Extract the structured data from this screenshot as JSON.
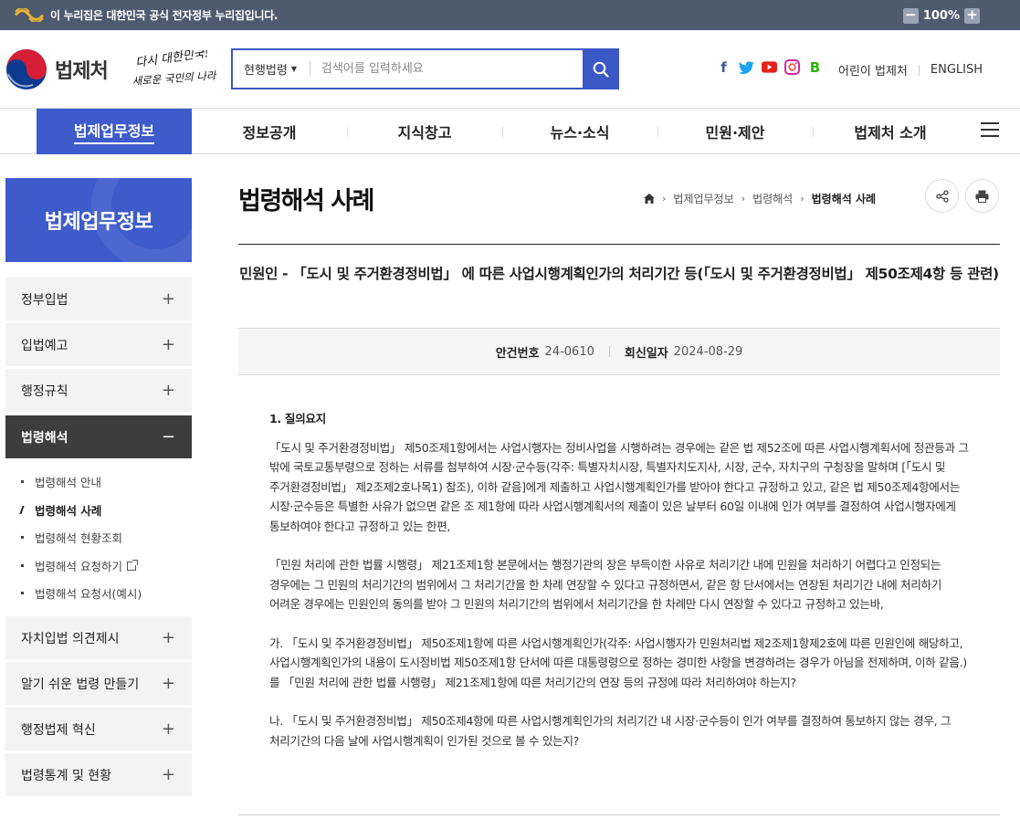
{
  "govbar": {
    "text": "이 누리집은 대한민국 공식 전자정부 누리집입니다.",
    "zoom_minus": "−",
    "zoom_value": "100%",
    "zoom_plus": "+"
  },
  "header": {
    "logo_text": "법제처",
    "slogan_line1": "다시 대한민국!",
    "slogan_line2": "새로운 국민의 나라",
    "search_select": "현행법령",
    "search_placeholder": "검색어를 입력하세요",
    "social": [
      "f",
      "t",
      "▶",
      "◎",
      "B"
    ],
    "util": [
      "어린이 법제처",
      "ENGLISH"
    ]
  },
  "gnb": {
    "items": [
      "법제업무정보",
      "정보공개",
      "지식창고",
      "뉴스·소식",
      "민원·제안",
      "법제처 소개"
    ]
  },
  "sidebar": {
    "title": "법제업무정보",
    "items_top": [
      "정부입법",
      "입법예고",
      "행정규칙"
    ],
    "open_item": "법령해석",
    "sub_items": [
      "법령해석 안내",
      "법령해석 사례",
      "법령해석 현황조회",
      "법령해석 요청하기",
      "법령해석 요청서(예시)"
    ],
    "items_bottom": [
      "자치입법 의견제시",
      "알기 쉬운 법령 만들기",
      "행정법제 혁신",
      "법령통계 및 현황"
    ],
    "plus": "+",
    "minus": "−"
  },
  "content": {
    "page_title": "법령해석 사례",
    "breadcrumb": [
      "법제업무정보",
      "법령해석",
      "법령해석 사례"
    ],
    "doc_title": "민원인 - 「도시 및 주거환경정비법」 에 따른 사업시행계획인가의 처리기간 등(「도시 및 주거환경정비법」 제50조제4항 등 관련)",
    "meta": {
      "case_label": "안건번호",
      "case_value": "24-0610",
      "date_label": "회신일자",
      "date_value": "2024-08-29"
    },
    "section_heading": "1. 질의요지",
    "paragraphs": [
      "「도시 및 주거환경정비법」 제50조제1항에서는 사업시행자는 정비사업을 시행하려는 경우에는 같은 법 제52조에 따른 사업시행계획서에 정관등과 그 밖에 국토교통부령으로 정하는 서류를 첨부하여 시장·군수등(각주: 특별자치시장, 특별자치도지사, 시장, 군수, 자치구의 구청장을 말하며 [「도시 및 주거환경정비법」 제2조제2호나목1) 참조), 이하 같음]에게 제출하고 사업시행계획인가를 받아야 한다고 규정하고 있고, 같은 법 제50조제4항에서는 시장·군수등은 특별한 사유가 없으면 같은 조 제1항에 따라 사업시행계획서의 제출이 있은 날부터 60일 이내에 인가 여부를 결정하여 사업시행자에게 통보하여야 한다고 규정하고 있는 한편,",
      "「민원 처리에 관한 법률 시행령」 제21조제1항 본문에서는 행정기관의 장은 부득이한 사유로 처리기간 내에 민원을 처리하기 어렵다고 인정되는 경우에는 그 민원의 처리기간의 범위에서 그 처리기간을 한 차례 연장할 수 있다고 규정하면서, 같은 항 단서에서는 연장된 처리기간 내에 처리하기 어려운 경우에는 민원인의 동의를 받아 그 민원의 처리기간의 범위에서 처리기간을 한 차례만 다시 연장할 수 있다고 규정하고 있는바,",
      "가. 「도시 및 주거환경정비법」 제50조제1항에 따른 사업시행계획인가(각주: 사업시행자가 민원처리법 제2조제1항제2호에 따른 민원인에 해당하고, 사업시행계획인가의 내용이 도시정비법 제50조제1항 단서에 따른 대통령령으로 정하는 경미한 사항을 변경하려는 경우가 아님을 전제하며, 이하 같음.)를 「민원 처리에 관한 법률 시행령」 제21조제1항에 따른 처리기간의 연장 등의 규정에 따라 처리하여야 하는지?",
      "나. 「도시 및 주거환경정비법」 제50조제4항에 따른 사업시행계획인가의 처리기간 내 시장·군수등이 인가 여부를 결정하여 통보하지 않는 경우, 그 처리기간의 다음 날에 사업시행계획이 인가된 것으로 볼 수 있는지?"
    ]
  }
}
